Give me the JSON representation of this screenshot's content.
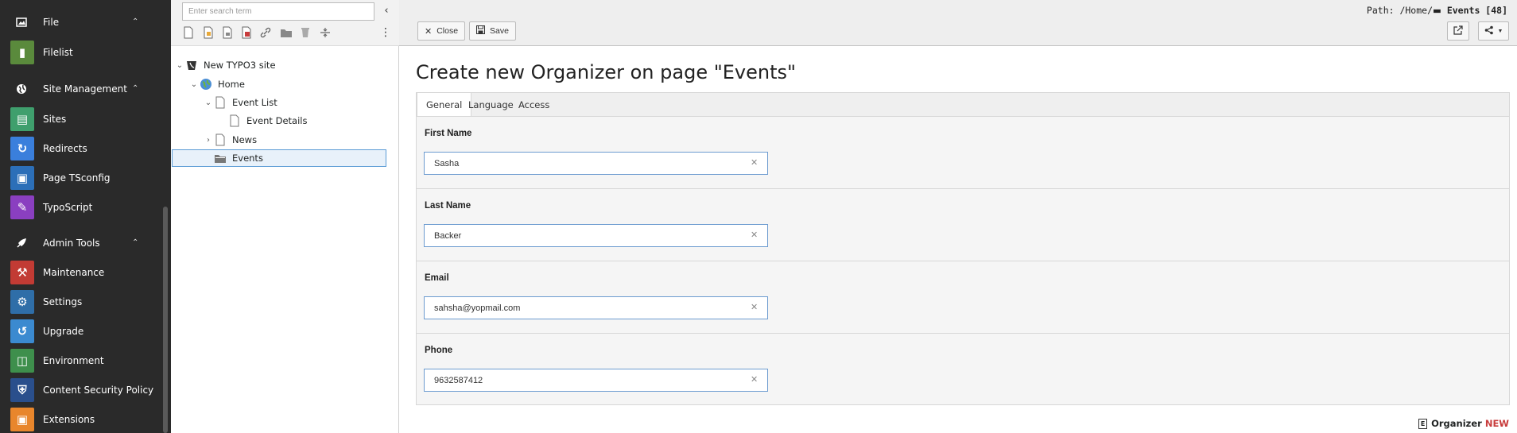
{
  "module_menu": {
    "groups": [
      {
        "label": "File",
        "icon": "file-group-icon"
      },
      {
        "label": "Site Management",
        "icon": "globe-icon"
      },
      {
        "label": "Admin Tools",
        "icon": "rocket-icon"
      }
    ],
    "items": [
      {
        "label": "Filelist",
        "color": "#5a8a3c"
      },
      {
        "label": "Sites",
        "color": "#3f9f6d"
      },
      {
        "label": "Redirects",
        "color": "#3a7fdc"
      },
      {
        "label": "Page TSconfig",
        "color": "#2c6fb8"
      },
      {
        "label": "TypoScript",
        "color": "#8a3fc0"
      },
      {
        "label": "Maintenance",
        "color": "#c23b34"
      },
      {
        "label": "Settings",
        "color": "#2f6ea8"
      },
      {
        "label": "Upgrade",
        "color": "#3b8ad0"
      },
      {
        "label": "Environment",
        "color": "#3e8f4c"
      },
      {
        "label": "Content Security Policy",
        "color": "#2a4f8c"
      },
      {
        "label": "Extensions",
        "color": "#e8862c"
      }
    ]
  },
  "page_tree": {
    "search_placeholder": "Enter search term",
    "nodes": [
      {
        "label": "New TYPO3 site"
      },
      {
        "label": "Home"
      },
      {
        "label": "Event List"
      },
      {
        "label": "Event Details"
      },
      {
        "label": "News"
      },
      {
        "label": "Events"
      }
    ]
  },
  "doc_header": {
    "close_label": "Close",
    "save_label": "Save",
    "path_prefix": "Path: /Home/",
    "path_page": "Events [48]"
  },
  "form": {
    "title": "Create new Organizer on page \"Events\"",
    "tabs": [
      "General",
      "Language",
      "Access"
    ],
    "fields": [
      {
        "label": "First Name",
        "value": "Sasha"
      },
      {
        "label": "Last Name",
        "value": "Backer"
      },
      {
        "label": "Email",
        "value": "sahsha@yopmail.com"
      },
      {
        "label": "Phone",
        "value": "9632587412"
      }
    ]
  },
  "footer": {
    "record_type": "Organizer",
    "status": "NEW"
  }
}
